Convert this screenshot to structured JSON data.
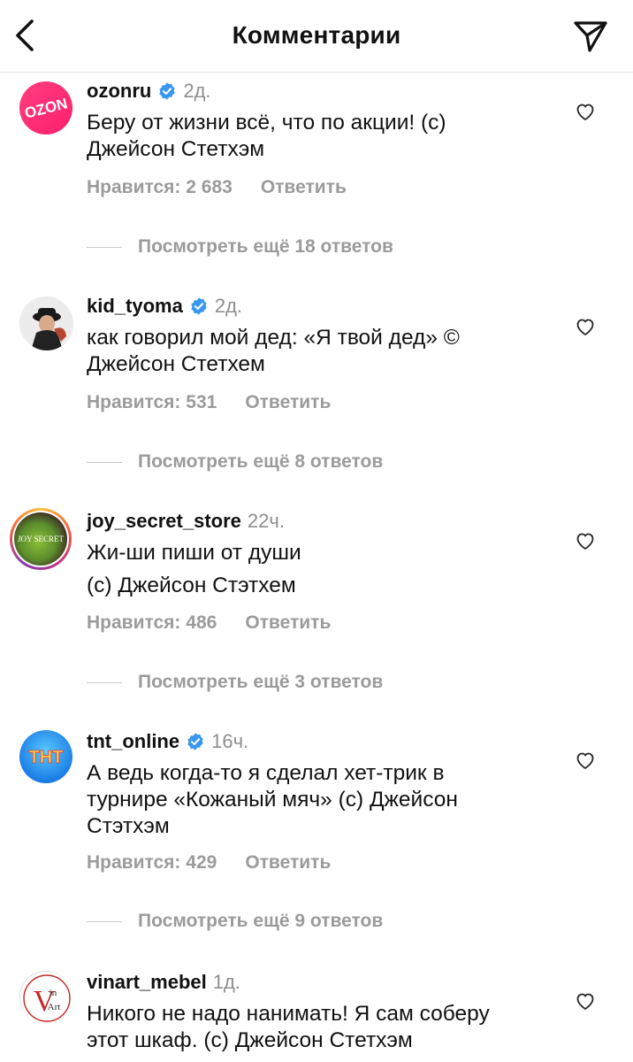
{
  "header": {
    "title": "Комментарии",
    "back_icon": "chevron-left-icon",
    "share_icon": "paper-plane-icon"
  },
  "comments": [
    {
      "username": "ozonru",
      "verified": true,
      "time": "2д.",
      "lines": [
        "Беру от жизни всё, что по акции! (с)",
        "Джейсон Стетхэм"
      ],
      "likes": "Нравится: 2 683",
      "reply": "Ответить",
      "more": "Посмотреть ещё 18 ответов",
      "avatar_text": "OZON"
    },
    {
      "username": "kid_tyoma",
      "verified": true,
      "time": "2д.",
      "lines": [
        "как говорил мой дед: «Я твой дед» ©",
        "Джейсон Стетхем"
      ],
      "likes": "Нравится: 531",
      "reply": "Ответить",
      "more": "Посмотреть ещё 8 ответов"
    },
    {
      "username": "joy_secret_store",
      "verified": false,
      "time": "22ч.",
      "lines": [
        "Жи-ши пиши от души",
        "(с) Джейсон Стэтхем"
      ],
      "likes": "Нравится: 486",
      "reply": "Ответить",
      "more": "Посмотреть ещё 3 ответов",
      "avatar_text": "JOY SECRET"
    },
    {
      "username": "tnt_online",
      "verified": true,
      "time": "16ч.",
      "lines": [
        "А ведь когда-то я сделал хет-трик в",
        "турнире «Кожаный мяч» (с) Джейсон",
        "Стэтхэм"
      ],
      "likes": "Нравится: 429",
      "reply": "Ответить",
      "more": "Посмотреть ещё 9 ответов",
      "avatar_text": "THT"
    },
    {
      "username": "vinart_mebel",
      "verified": false,
      "time": "1д.",
      "lines": [
        "Никого не надо нанимать! Я сам соберу",
        "этот шкаф. (с) Джейсон Стетхэм"
      ],
      "avatar_text_main": "V",
      "avatar_text_top": "in",
      "avatar_text_bottom": "Art"
    }
  ],
  "colors": {
    "verified": "#3897f0",
    "secondary_text": "#9b9b9b"
  }
}
